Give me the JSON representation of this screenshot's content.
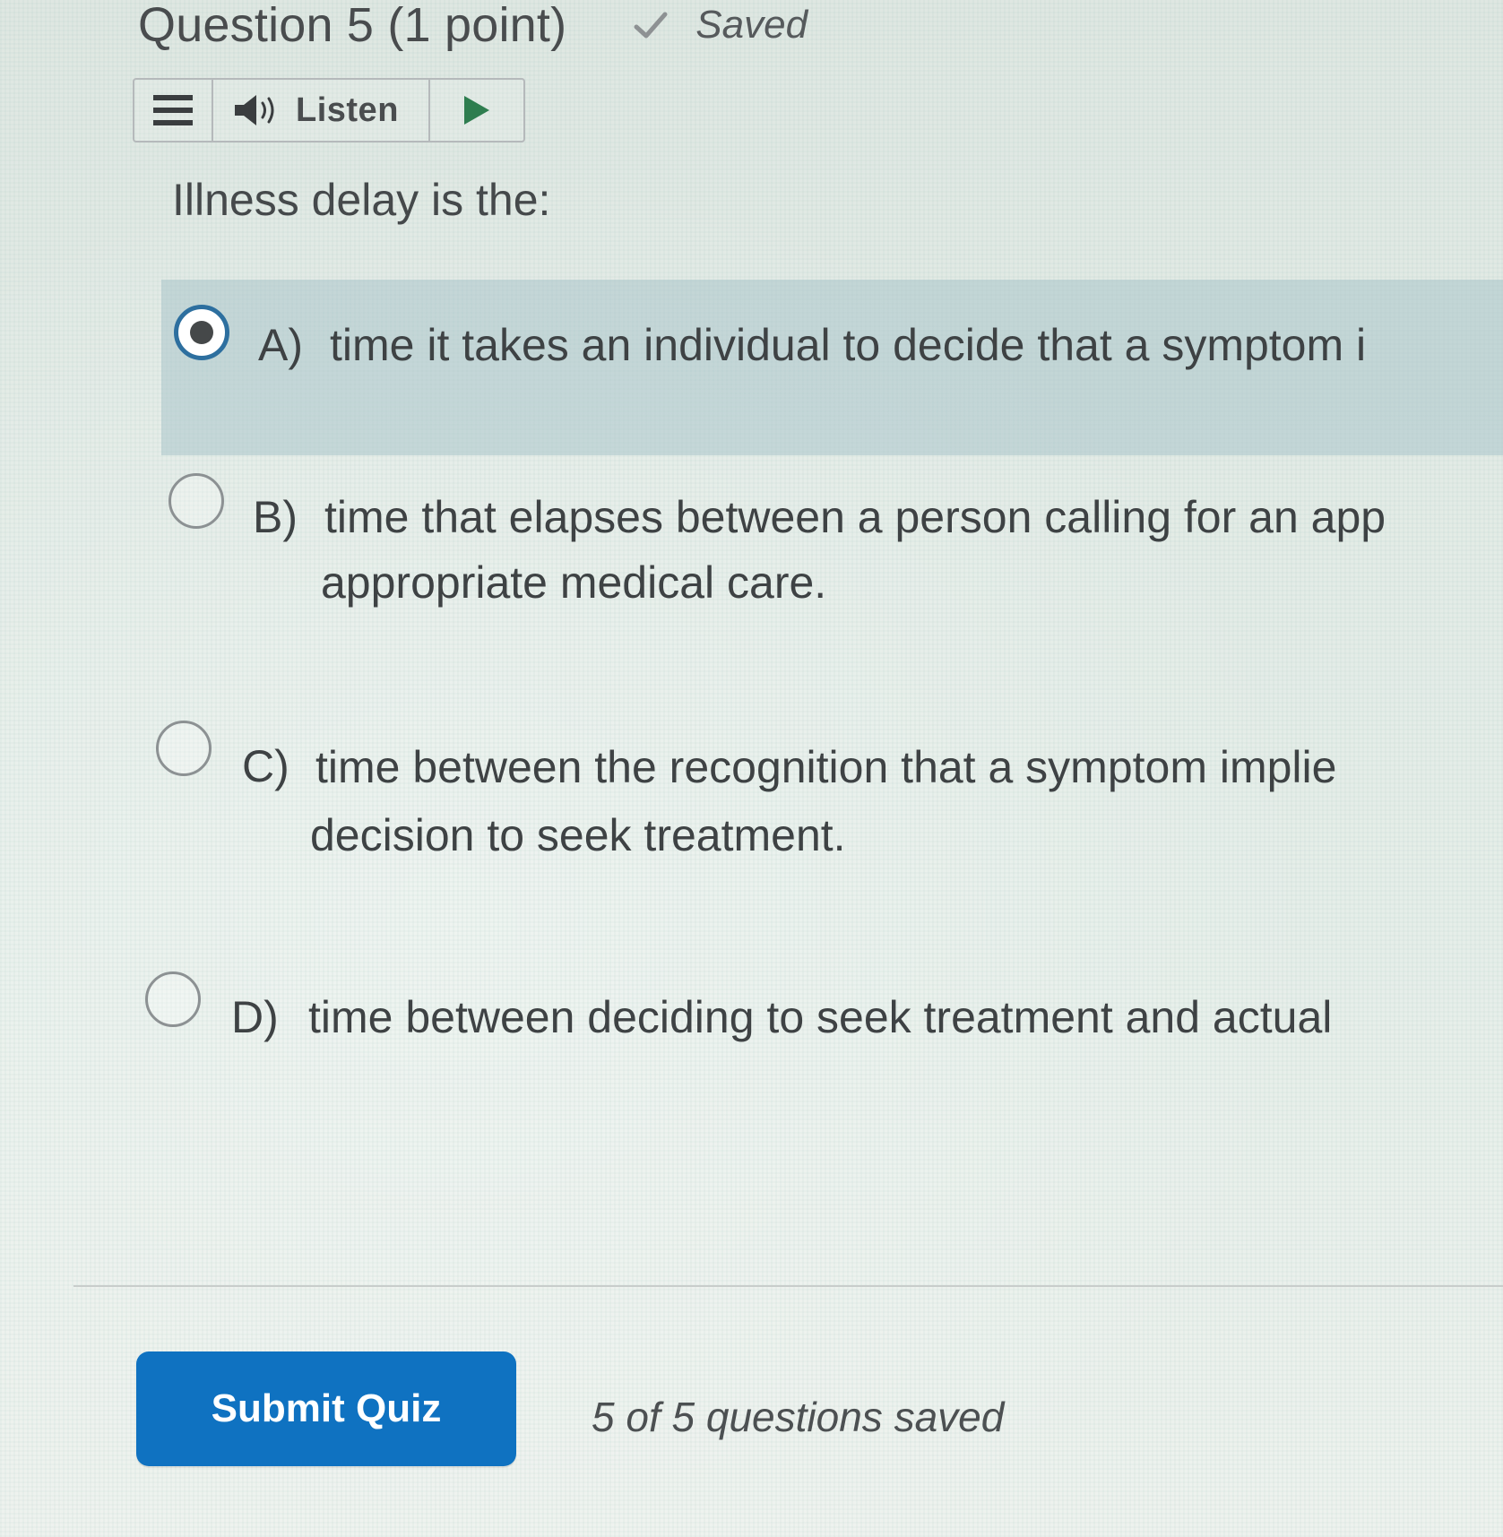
{
  "header": {
    "question_title": "Question 5 (1 point)",
    "saved_label": "Saved",
    "saved_icon": "checkmark-icon"
  },
  "toolbar": {
    "menu_icon": "hamburger-menu-icon",
    "speaker_icon": "speaker-icon",
    "listen_label": "Listen",
    "play_icon": "play-icon"
  },
  "question": {
    "prompt": "Illness delay is the:",
    "selected_option": "A",
    "options": [
      {
        "letter": "A)",
        "lines": [
          "time it takes an individual to decide that a symptom i"
        ],
        "selected": true
      },
      {
        "letter": "B)",
        "lines": [
          "time that elapses between a person calling for an app",
          "appropriate medical care."
        ],
        "selected": false
      },
      {
        "letter": "C)",
        "lines": [
          "time between the recognition that a symptom implie",
          "decision to seek treatment."
        ],
        "selected": false
      },
      {
        "letter": "D)",
        "lines": [
          "time between deciding to seek treatment and actual"
        ],
        "selected": false
      }
    ]
  },
  "footer": {
    "submit_label": "Submit Quiz",
    "save_status": "5 of 5 questions saved"
  },
  "colors": {
    "accent_blue": "#0f72c1",
    "selected_row_bg": "#aac4ca",
    "radio_selected_ring": "#2d6f9f"
  }
}
